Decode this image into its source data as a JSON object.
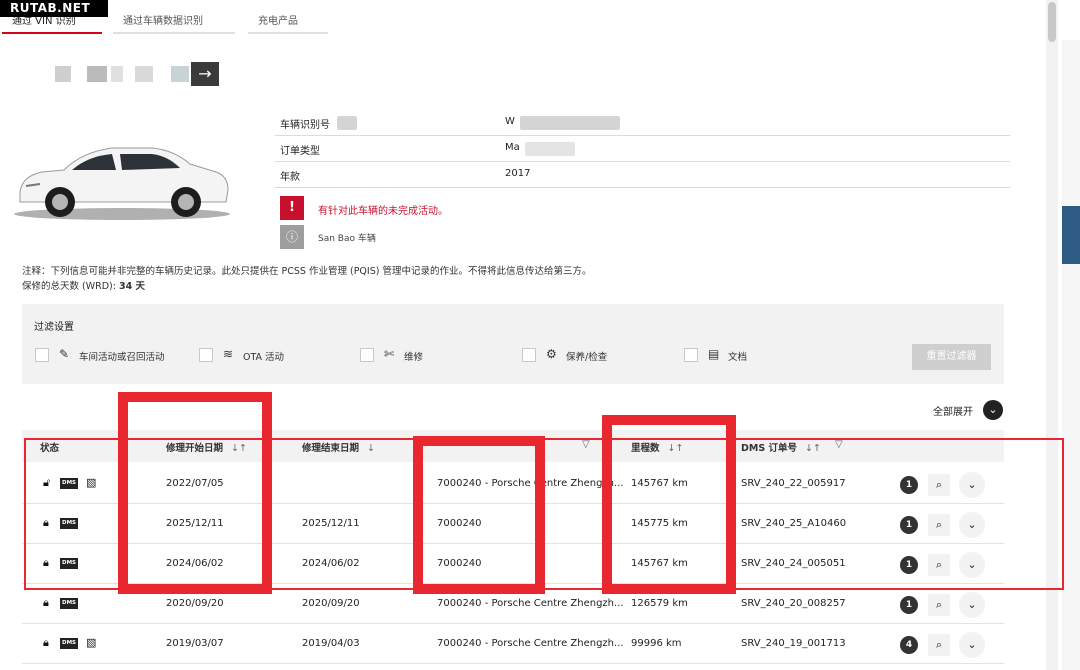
{
  "watermark": "RUTAB.NET",
  "tabs": [
    {
      "label": "通过 VIN 识别",
      "active": true
    },
    {
      "label": "通过车辆数据识别",
      "active": false
    },
    {
      "label": "充电产品",
      "active": false
    }
  ],
  "vehicle": {
    "fields": [
      {
        "label": "车辆识别号",
        "value": "W"
      },
      {
        "label": "订单类型",
        "value": "Ma"
      },
      {
        "label": "年款",
        "value": "2017"
      }
    ],
    "alert_text": "有针对此车辆的未完成活动。",
    "alert_icon": "exclamation-icon",
    "notice_text": "San Bao 车辆",
    "notice_icon": "info-icon"
  },
  "note": {
    "line1": "注释：下列信息可能并非完整的车辆历史记录。此处只提供在 PCSS 作业管理 (PQIS) 管理中记录的作业。不得将此信息传达给第三方。",
    "line2_label": "保修的总天数 (WRD):",
    "line2_value": "34 天"
  },
  "filter": {
    "title": "过滤设置",
    "items": [
      {
        "label": "车间活动或召回活动",
        "icon": "wrench-tag-icon"
      },
      {
        "label": "OTA 活动",
        "icon": "wifi-icon"
      },
      {
        "label": "维修",
        "icon": "wrench-icon"
      },
      {
        "label": "保养/检查",
        "icon": "gear-icon"
      },
      {
        "label": "文档",
        "icon": "document-icon"
      }
    ],
    "reset_label": "重置过滤器"
  },
  "expand_all": "全部展开",
  "table": {
    "columns": [
      "状态",
      "修理开始日期",
      "修理结束日期",
      "",
      "里程数",
      "DMS 订单号"
    ],
    "rows": [
      {
        "start": "2022/07/05",
        "end": "",
        "dealer": "7000240 - Porsche Centre Zhengzh...",
        "mileage": "145767 km",
        "order": "SRV_240_22_005917",
        "count": "1",
        "unlocked": true,
        "doc": true
      },
      {
        "start": "2025/12/11",
        "end": "2025/12/11",
        "dealer": "7000240",
        "mileage": "145775 km",
        "order": "SRV_240_25_A10460",
        "count": "1",
        "unlocked": false,
        "doc": false
      },
      {
        "start": "2024/06/02",
        "end": "2024/06/02",
        "dealer": "7000240",
        "mileage": "145767 km",
        "order": "SRV_240_24_005051",
        "count": "1",
        "unlocked": false,
        "doc": false
      },
      {
        "start": "2020/09/20",
        "end": "2020/09/20",
        "dealer": "7000240 - Porsche Centre Zhengzh...",
        "mileage": "126579 km",
        "order": "SRV_240_20_008257",
        "count": "1",
        "unlocked": false,
        "doc": false
      },
      {
        "start": "2019/03/07",
        "end": "2019/04/03",
        "dealer": "7000240 - Porsche Centre Zhengzh...",
        "mileage": "99996 km",
        "order": "SRV_240_19_001713",
        "count": "4",
        "unlocked": false,
        "doc": true
      }
    ],
    "dms_badge": "DMS"
  },
  "colors": {
    "accent": "#d5001c",
    "highlight": "#e8272e",
    "alert": "#c8102e"
  }
}
